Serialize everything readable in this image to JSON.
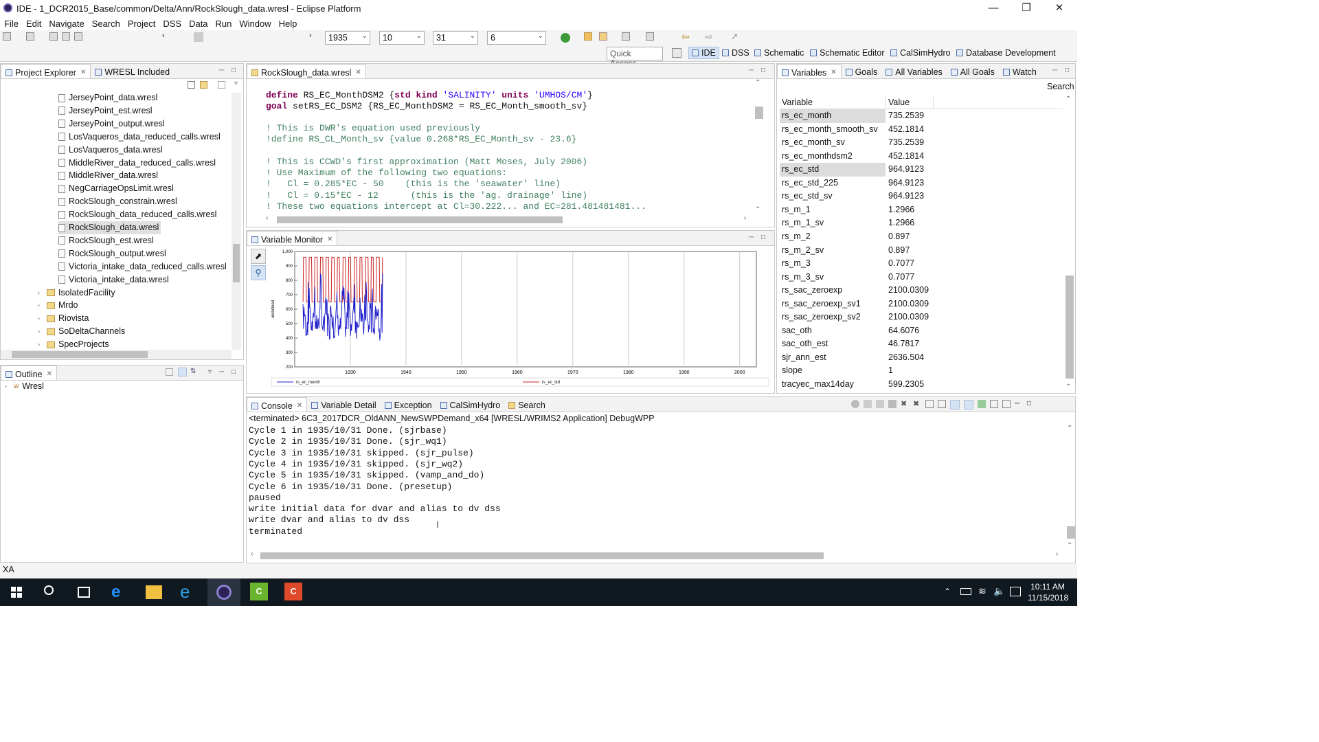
{
  "window": {
    "title": "IDE - 1_DCR2015_Base/common/Delta/Ann/RockSlough_data.wresl - Eclipse Platform"
  },
  "menu": [
    "File",
    "Edit",
    "Navigate",
    "Search",
    "Project",
    "DSS",
    "Data",
    "Run",
    "Window",
    "Help"
  ],
  "toolbar": {
    "year": "1935",
    "month": "10",
    "day": "31",
    "cycle": "6"
  },
  "perspectives": {
    "quick_access": "Quick Access",
    "items": [
      "IDE",
      "DSS",
      "Schematic",
      "Schematic Editor",
      "CalSimHydro",
      "Database Development"
    ],
    "active": "IDE"
  },
  "project_explorer": {
    "tabs": [
      "Project Explorer",
      "WRESL Included"
    ],
    "files": [
      "JerseyPoint_data.wresl",
      "JerseyPoint_est.wresl",
      "JerseyPoint_output.wresl",
      "LosVaqueros_data_reduced_calls.wresl",
      "LosVaqueros_data.wresl",
      "MiddleRiver_data_reduced_calls.wresl",
      "MiddleRiver_data.wresl",
      "NegCarriageOpsLimit.wresl",
      "RockSlough_constrain.wresl",
      "RockSlough_data_reduced_calls.wresl",
      "RockSlough_data.wresl",
      "RockSlough_est.wresl",
      "RockSlough_output.wresl",
      "Victoria_intake_data_reduced_calls.wresl",
      "Victoria_intake_data.wresl"
    ],
    "folders": [
      "IsolatedFacility",
      "Mrdo",
      "Riovista",
      "SoDeltaChannels",
      "SpecProjects"
    ]
  },
  "outline": {
    "tab": "Outline",
    "item": "Wresl"
  },
  "editor": {
    "tab": "RockSlough_data.wresl",
    "lines": [
      {
        "kw": "define",
        "rest": " RS_EC_MonthDSM2 {",
        "kw2": "std kind",
        "s1": "'SALINITY'",
        "kw3": " units ",
        "s2": "'UMHOS/CM'",
        "end": "}"
      },
      {
        "text": "goal setRS_EC_DSM2 {RS_EC_MonthDSM2 = RS_EC_Month_smooth_sv}"
      },
      {
        "comment": "! This is DWR's equation used previously"
      },
      {
        "comment": "!define RS_CL_Month_sv {value 0.268*RS_EC_Month_sv - 23.6}"
      },
      {
        "comment": "! This is CCWD's first approximation (Matt Moses, July 2006)"
      },
      {
        "comment": "! Use Maximum of the following two equations:"
      },
      {
        "comment": "!   Cl = 0.285*EC - 50    (this is the 'seawater' line)"
      },
      {
        "comment": "!   Cl = 0.15*EC - 12      (this is the 'ag. drainage' line)"
      },
      {
        "comment": "! These two equations intercept at Cl=30.222... and EC=281.481481481..."
      }
    ]
  },
  "variable_monitor": {
    "tab": "Variable Monitor"
  },
  "chart_data": {
    "type": "line",
    "xlim": [
      1920,
      2003
    ],
    "ylim": [
      200,
      1000
    ],
    "x_ticks": [
      "1930",
      "1940",
      "1950",
      "1960",
      "1970",
      "1980",
      "1990",
      "2000"
    ],
    "y_ticks": [
      "200",
      "300",
      "400",
      "500",
      "600",
      "700",
      "800",
      "900",
      "1,000"
    ],
    "ylabel": "undefined",
    "series": [
      {
        "name": "rs_ec_month",
        "color": "#2222cc"
      },
      {
        "name": "rs_ec_std",
        "color": "#cc2222"
      }
    ],
    "x_span": [
      1921.5,
      1935.8
    ],
    "std_range": [
      650,
      960
    ],
    "month_range": [
      210,
      900
    ]
  },
  "variables": {
    "tabs": [
      "Variables",
      "Goals",
      "All Variables",
      "All Goals",
      "Watch"
    ],
    "search_label": "Search",
    "headers": [
      "Variable",
      "Value"
    ],
    "rows": [
      [
        "rs_ec_month",
        "735.2539"
      ],
      [
        "rs_ec_month_smooth_sv",
        "452.1814"
      ],
      [
        "rs_ec_month_sv",
        "735.2539"
      ],
      [
        "rs_ec_monthdsm2",
        "452.1814"
      ],
      [
        "rs_ec_std",
        "964.9123"
      ],
      [
        "rs_ec_std_225",
        "964.9123"
      ],
      [
        "rs_ec_std_sv",
        "964.9123"
      ],
      [
        "rs_m_1",
        "1.2966"
      ],
      [
        "rs_m_1_sv",
        "1.2966"
      ],
      [
        "rs_m_2",
        "0.897"
      ],
      [
        "rs_m_2_sv",
        "0.897"
      ],
      [
        "rs_m_3",
        "0.7077"
      ],
      [
        "rs_m_3_sv",
        "0.7077"
      ],
      [
        "rs_sac_zeroexp",
        "2100.0309"
      ],
      [
        "rs_sac_zeroexp_sv1",
        "2100.0309"
      ],
      [
        "rs_sac_zeroexp_sv2",
        "2100.0309"
      ],
      [
        "sac_oth",
        "64.6076"
      ],
      [
        "sac_oth_est",
        "46.7817"
      ],
      [
        "sjr_ann_est",
        "2636.504"
      ],
      [
        "slope",
        "1"
      ],
      [
        "tracyec_max14day",
        "599.2305"
      ]
    ]
  },
  "console": {
    "tabs": [
      "Console",
      "Variable Detail",
      "Exception",
      "CalSimHydro",
      "Search"
    ],
    "header": "<terminated> 6C3_2017DCR_OldANN_NewSWPDemand_x64 [WRESL/WRIMS2 Application] DebugWPP",
    "lines": [
      "Cycle 1 in 1935/10/31 Done. (sjrbase)",
      "Cycle 2 in 1935/10/31 Done. (sjr_wq1)",
      "Cycle 3 in 1935/10/31 skipped. (sjr_pulse)",
      "Cycle 4 in 1935/10/31 skipped. (sjr_wq2)",
      "Cycle 5 in 1935/10/31 skipped. (vamp_and_do)",
      "Cycle 6 in 1935/10/31 Done. (presetup)",
      "paused",
      "write initial data for dvar and alias to dv dss",
      "write dvar and alias to dv dss",
      "terminated"
    ]
  },
  "status": {
    "text": "XA"
  },
  "clock": {
    "time": "10:11 AM",
    "date": "11/15/2018"
  }
}
